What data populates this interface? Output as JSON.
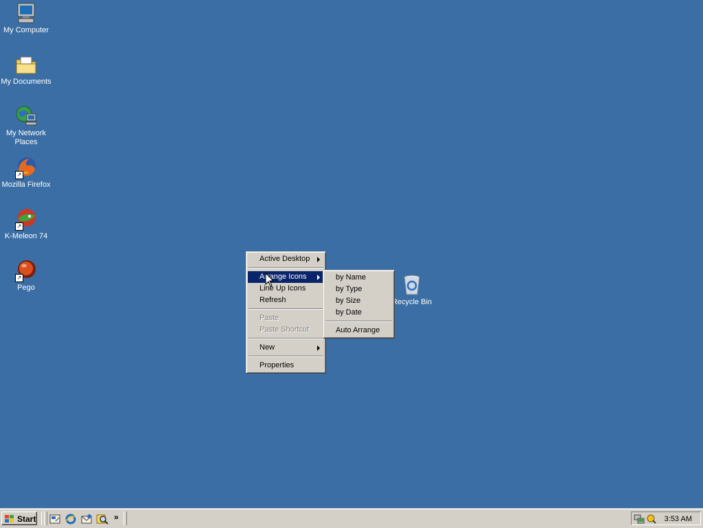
{
  "desktop": {
    "icons": [
      {
        "label": "My Computer",
        "icon": "my-computer-icon"
      },
      {
        "label": "My Documents",
        "icon": "my-documents-folder-icon"
      },
      {
        "label": "My Network Places",
        "icon": "network-places-icon"
      },
      {
        "label": "Mozilla Firefox",
        "icon": "firefox-icon"
      },
      {
        "label": "K-Meleon 74",
        "icon": "k-meleon-icon"
      },
      {
        "label": "Pego",
        "icon": "pego-icon"
      },
      {
        "label": "Recycle Bin",
        "icon": "recycle-bin-icon"
      }
    ],
    "background_color": "#3a6ea5"
  },
  "context_menu": {
    "items": [
      {
        "label": "Active Desktop",
        "submenu": true
      },
      {
        "label": "Arrange Icons",
        "submenu": true,
        "highlighted": true
      },
      {
        "label": "Line Up Icons"
      },
      {
        "label": "Refresh"
      },
      {
        "label": "Paste",
        "disabled": true
      },
      {
        "label": "Paste Shortcut",
        "disabled": true
      },
      {
        "label": "New",
        "submenu": true
      },
      {
        "label": "Properties"
      }
    ],
    "highlight_color": "#0a246a"
  },
  "arrange_submenu": {
    "items": [
      {
        "label": "by Name"
      },
      {
        "label": "by Type"
      },
      {
        "label": "by Size"
      },
      {
        "label": "by Date"
      },
      {
        "label": "Auto Arrange"
      }
    ]
  },
  "taskbar": {
    "start_label": "Start",
    "quick_launch": [
      "show-desktop-icon",
      "internet-explorer-icon",
      "outlook-express-icon",
      "search-icon"
    ],
    "chevron": "»",
    "clock": "3:53 AM",
    "tray_icons": [
      "network-tray-icon",
      "volume-tray-icon"
    ]
  }
}
